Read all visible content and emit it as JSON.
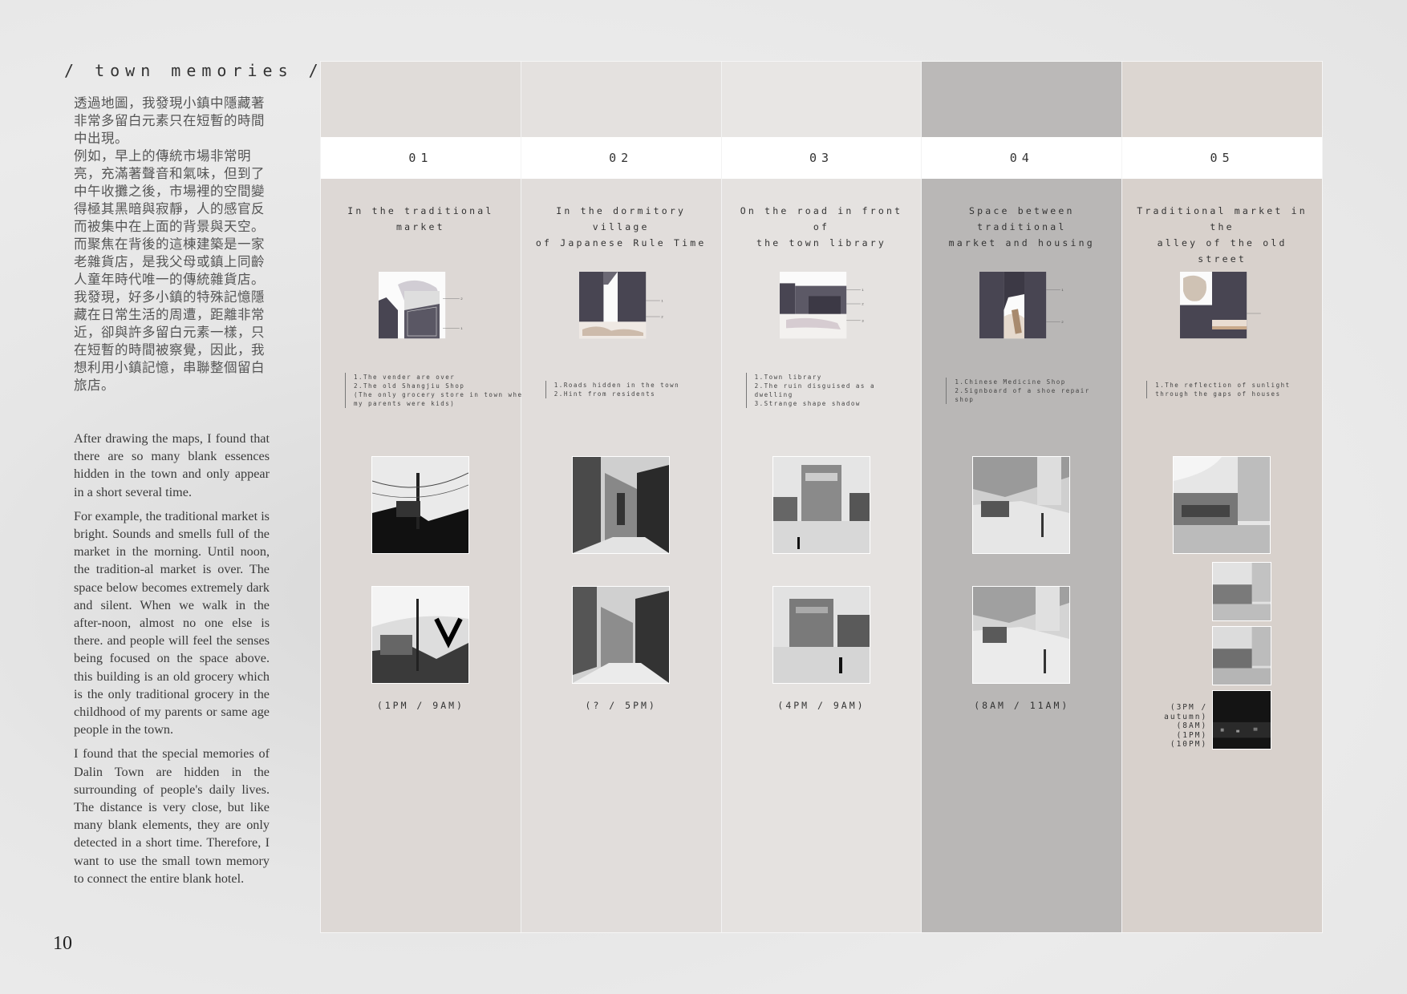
{
  "page": {
    "section_title": "/  town memories  /",
    "page_number": "10"
  },
  "intro_zh": [
    "透過地圖，我發現小鎮中隱藏著非常多留白元素只在短暫的時間中出現。",
    "例如，早上的傳統市場非常明亮，充滿著聲音和氣味，但到了中午收攤之後，市場裡的空間變得極其黑暗與寂靜，人的感官反而被集中在上面的背景與天空。而聚焦在背後的這棟建築是一家老雜貨店，是我父母或鎮上同齡人童年時代唯一的傳統雜貨店。",
    "我發現，好多小鎮的特殊記憶隱藏在日常生活的周遭，距離非常近，卻與許多留白元素一樣，只在短暫的時間被察覺，因此，我想利用小鎮記憶，串聯整個留白旅店。"
  ],
  "intro_en": [
    "After drawing the maps, I found that there are so many blank essences hidden in the town and only appear in a short several time.",
    "For example, the traditional market is bright. Sounds and smells full of the market in the morning. Until noon, the tradition-al market is over. The space below becomes extremely dark and silent. When we walk in the after-noon, almost no one else is there. and people will feel the senses being focused on the space above. this building is an old grocery which is the only traditional grocery in the childhood of my parents or same age people in the town.",
    "I found that the special memories of Dalin Town are hidden in the surrounding of people's daily lives. The distance is very close, but like many blank elements, they are only detected in a short time. Therefore, I want to use the small town memory to connect the entire blank hotel."
  ],
  "columns": [
    {
      "number": "01",
      "location": "In the traditional market",
      "bg": "#ddd8d5",
      "top_bg": "#e0dcd9",
      "notes": [
        "1.The vender are over",
        "2.The old Shangjiu Shop",
        " (The only grocery store in town when",
        "my parents were kids)"
      ],
      "time": "(1PM / 9AM)"
    },
    {
      "number": "02",
      "location": "In the dormitory village\nof Japanese Rule Time",
      "bg": "#e1dddb",
      "top_bg": "#e4e1df",
      "notes": [
        "1.Roads hidden in the town",
        "2.Hint from residents"
      ],
      "time": "(? / 5PM)"
    },
    {
      "number": "03",
      "location": "On the road in front of\nthe town library",
      "bg": "#e5e2e0",
      "top_bg": "#e8e6e4",
      "notes": [
        "1.Town library",
        "2.The ruin disguised as a",
        "  dwelling",
        "3.Strange shape shadow"
      ],
      "time": "(4PM / 9AM)"
    },
    {
      "number": "04",
      "location": "Space between traditional\nmarket and housing",
      "bg": "#b9b7b6",
      "top_bg": "#bbb9b8",
      "notes": [
        "1.Chinese Medicine Shop",
        "2.Signboard of a shoe repair",
        "  shop"
      ],
      "time": "(8AM / 11AM)"
    },
    {
      "number": "05",
      "location": "Traditional market in the\nalley of the old street",
      "bg": "#d8d1cc",
      "top_bg": "#dcd6d1",
      "notes": [
        "1.The reflection of sunlight",
        "  through the gaps of houses"
      ],
      "time_stack": [
        "(3PM /",
        "autumn)",
        "(8AM)",
        "(1PM)",
        "(10PM)"
      ]
    }
  ]
}
